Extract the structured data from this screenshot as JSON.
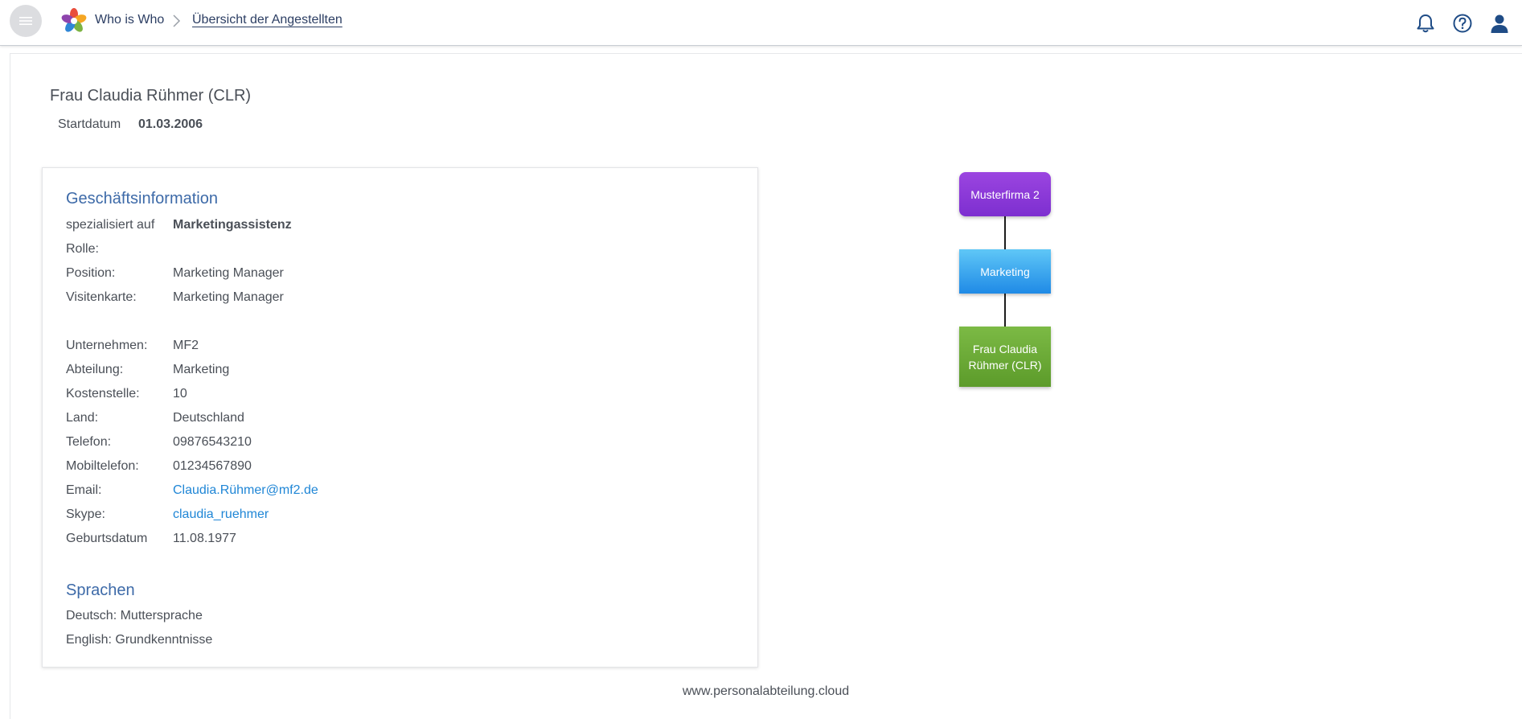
{
  "header": {
    "app_name": "Who is Who",
    "breadcrumb_current": "Übersicht der Angestellten"
  },
  "employee": {
    "name": "Frau Claudia Rühmer (CLR)",
    "start_label": "Startdatum",
    "start_value": "01.03.2006"
  },
  "business": {
    "title": "Geschäftsinformation",
    "rows": [
      {
        "label": "spezialisiert auf",
        "value": "Marketingassistenz"
      },
      {
        "label": "Rolle:",
        "value": ""
      },
      {
        "label": "Position:",
        "value": "Marketing Manager"
      },
      {
        "label": "Visitenkarte:",
        "value": "Marketing Manager"
      },
      {
        "label": "Unternehmen:",
        "value": "MF2"
      },
      {
        "label": "Abteilung:",
        "value": "Marketing"
      },
      {
        "label": "Kostenstelle:",
        "value": "10"
      },
      {
        "label": "Land:",
        "value": "Deutschland"
      },
      {
        "label": "Telefon:",
        "value": "09876543210"
      },
      {
        "label": "Mobiltelefon:",
        "value": "01234567890"
      },
      {
        "label": "Email:",
        "value": "Claudia.Rühmer@mf2.de"
      },
      {
        "label": "Skype:",
        "value": "claudia_ruehmer"
      },
      {
        "label": "Geburtsdatum",
        "value": "11.08.1977"
      }
    ]
  },
  "languages": {
    "title": "Sprachen",
    "items": [
      "Deutsch: Muttersprache",
      "English: Grundkenntnisse"
    ]
  },
  "org_chart": {
    "company": "Musterfirma 2",
    "department": "Marketing",
    "person": "Frau Claudia Rühmer (CLR)"
  },
  "footer": {
    "text": "www.personalabteilung.cloud"
  },
  "colors": {
    "accent": "#3d6aa8",
    "link": "#1f86d6",
    "company_node": "#8a3bd8",
    "department_node": "#2f9bea",
    "person_node": "#6aaa36"
  },
  "icons": [
    "menu-icon",
    "app-logo-icon",
    "chevron-right-icon",
    "bell-icon",
    "help-icon",
    "user-icon"
  ]
}
